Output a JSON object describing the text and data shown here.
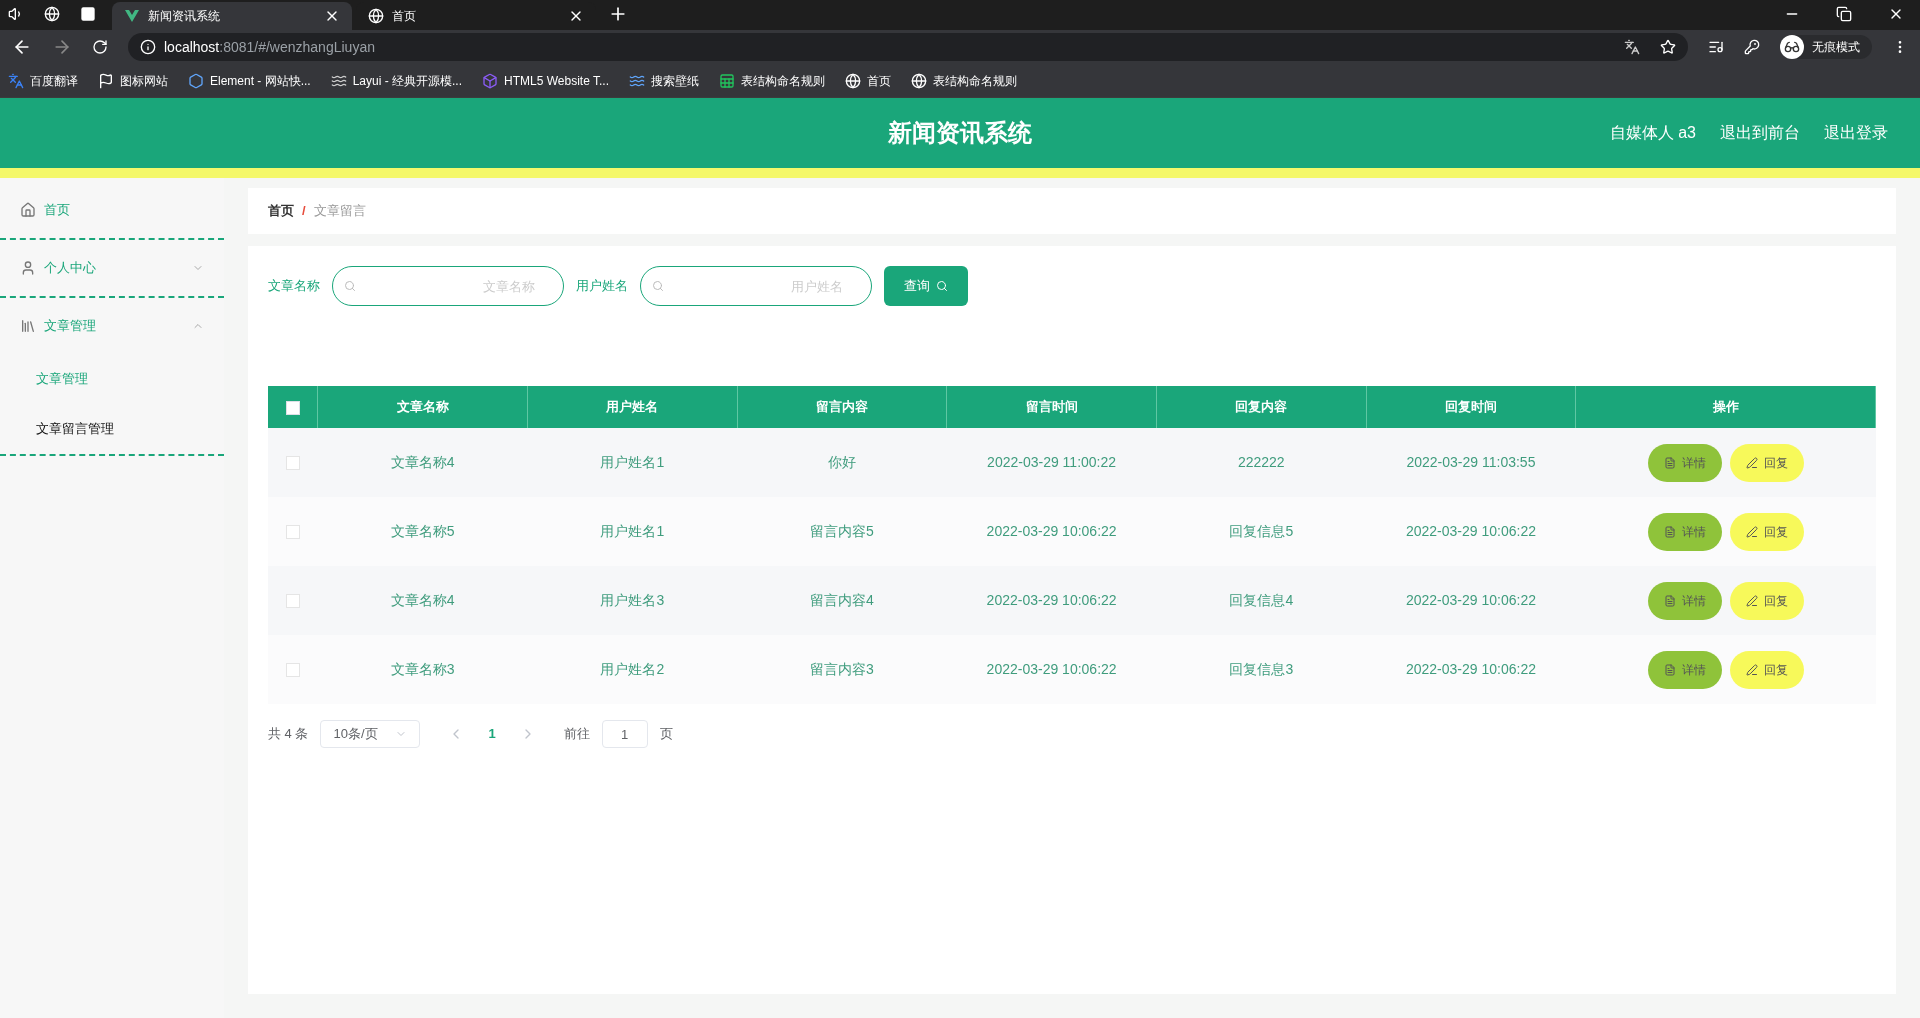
{
  "browser": {
    "tabs": [
      {
        "title": "新闻资讯系统",
        "selected": true,
        "kind": "vue"
      },
      {
        "title": "首页",
        "selected": false,
        "kind": "globe"
      }
    ],
    "address": {
      "host": "localhost",
      "rest": ":8081/#/wenzhangLiuyan"
    },
    "profile": "无痕模式",
    "bookmarks": [
      {
        "label": "百度翻译",
        "kind": "translate"
      },
      {
        "label": "图标网站",
        "kind": "flag"
      },
      {
        "label": "Element - 网站快...",
        "kind": "hex"
      },
      {
        "label": "Layui - 经典开源模...",
        "kind": "layui"
      },
      {
        "label": "HTML5 Website T...",
        "kind": "box"
      },
      {
        "label": "搜索壁纸",
        "kind": "wave"
      },
      {
        "label": "表结构命名规则",
        "kind": "sheet"
      },
      {
        "label": "首页",
        "kind": "globe"
      },
      {
        "label": "表结构命名规则",
        "kind": "globe"
      }
    ]
  },
  "header": {
    "title": "新闻资讯系统",
    "links": [
      "自媒体人 a3",
      "退出到前台",
      "退出登录"
    ]
  },
  "sidebar": {
    "items": [
      {
        "label": "首页",
        "kind": "home"
      },
      {
        "label": "个人中心",
        "kind": "user",
        "expanded": false
      },
      {
        "label": "文章管理",
        "kind": "book",
        "expanded": true,
        "children": [
          {
            "label": "文章管理",
            "selected": false
          },
          {
            "label": "文章留言管理",
            "selected": true
          }
        ]
      }
    ]
  },
  "breadcrumb": [
    "首页",
    "文章留言"
  ],
  "breadcrumb_separator": "/",
  "search": {
    "fields": [
      {
        "label": "文章名称",
        "placeholder": "文章名称"
      },
      {
        "label": "用户姓名",
        "placeholder": "用户姓名"
      }
    ],
    "button": "查询"
  },
  "table": {
    "all_checked": false,
    "columns": [
      "文章名称",
      "用户姓名",
      "留言内容",
      "留言时间",
      "回复内容",
      "回复时间",
      "操作"
    ],
    "rows": [
      {
        "checked": false,
        "cells": [
          "文章名称4",
          "用户姓名1",
          "你好",
          "2022-03-29 11:00:22",
          "222222",
          "2022-03-29 11:03:55"
        ],
        "actions": [
          "详情",
          "回复"
        ]
      },
      {
        "checked": false,
        "cells": [
          "文章名称5",
          "用户姓名1",
          "留言内容5",
          "2022-03-29 10:06:22",
          "回复信息5",
          "2022-03-29 10:06:22"
        ],
        "actions": [
          "详情",
          "回复"
        ]
      },
      {
        "checked": false,
        "cells": [
          "文章名称4",
          "用户姓名3",
          "留言内容4",
          "2022-03-29 10:06:22",
          "回复信息4",
          "2022-03-29 10:06:22"
        ],
        "actions": [
          "详情",
          "回复"
        ]
      },
      {
        "checked": false,
        "cells": [
          "文章名称3",
          "用户姓名2",
          "留言内容3",
          "2022-03-29 10:06:22",
          "回复信息3",
          "2022-03-29 10:06:22"
        ],
        "actions": [
          "详情",
          "回复"
        ]
      }
    ]
  },
  "pagination": {
    "total": "共 4 条",
    "page_size": "10条/页",
    "pages": [
      {
        "label": "1",
        "selected": true
      }
    ],
    "goto_label": "前往",
    "goto_value": "1",
    "goto_suffix": "页"
  }
}
